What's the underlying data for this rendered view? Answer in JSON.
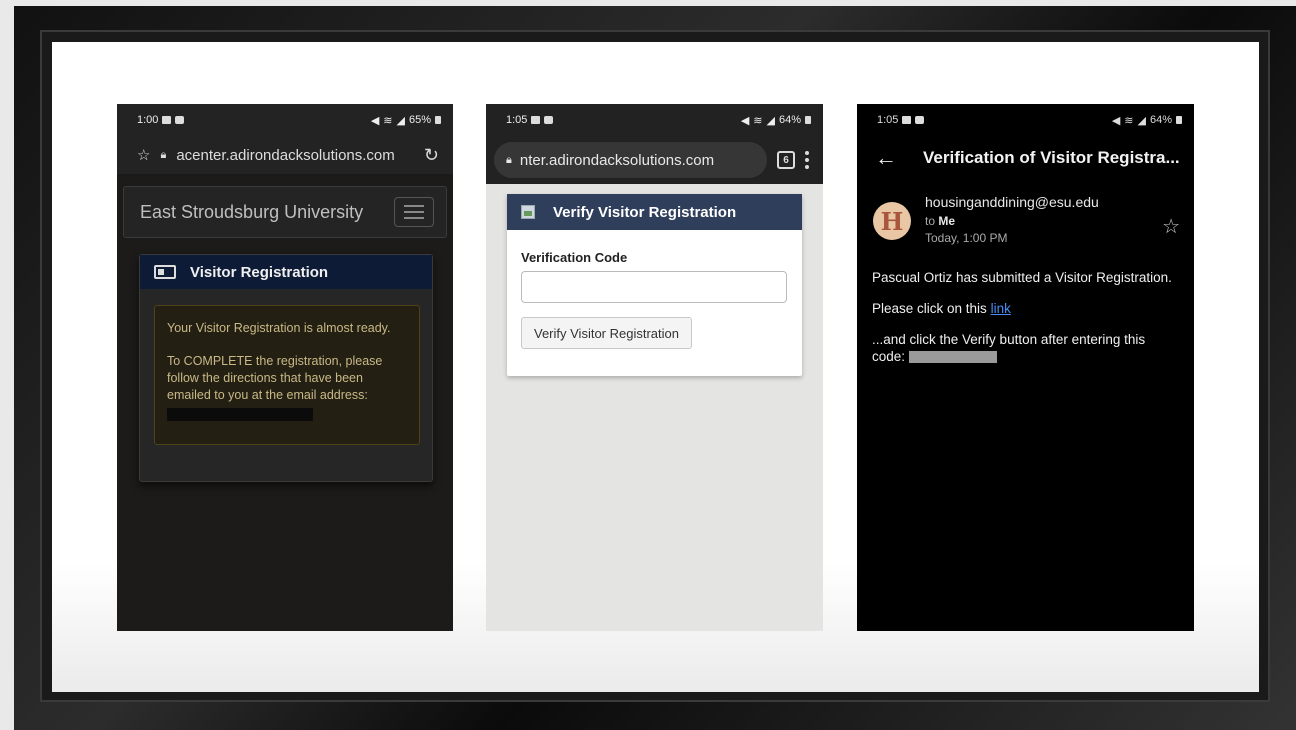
{
  "phone1": {
    "status": {
      "time": "1:00",
      "battery": "65%"
    },
    "url": "acenter.adirondacksolutions.com",
    "brand": "East Stroudsburg University",
    "card_title": "Visitor Registration",
    "alert_line1": "Your Visitor Registration is almost ready.",
    "alert_line2": "To COMPLETE the registration, please follow the directions that have been emailed to you at the email address:"
  },
  "phone2": {
    "status": {
      "time": "1:05",
      "battery": "64%"
    },
    "url": "nter.adirondacksolutions.com",
    "tab_count": "6",
    "card_title": "Verify Visitor Registration",
    "field_label": "Verification Code",
    "field_value": "",
    "button_label": "Verify Visitor Registration"
  },
  "phone3": {
    "status": {
      "time": "1:05",
      "battery": "64%"
    },
    "subject": "Verification of Visitor Registra...",
    "avatar_letter": "H",
    "sender": "housinganddining@esu.edu",
    "to_prefix": "to",
    "to_name": "Me",
    "date": "Today, 1:00 PM",
    "body_line1": "Pascual Ortiz has submitted a Visitor Registration.",
    "body_line2_prefix": "Please click on this",
    "link_text": "link",
    "body_line3": "...and click the Verify button after entering this code:"
  },
  "icons": {
    "status_left": [
      "image-icon",
      "video-icon"
    ],
    "status_right": [
      "mute-icon",
      "wifi-icon",
      "signal-icon",
      "battery-icon"
    ]
  }
}
